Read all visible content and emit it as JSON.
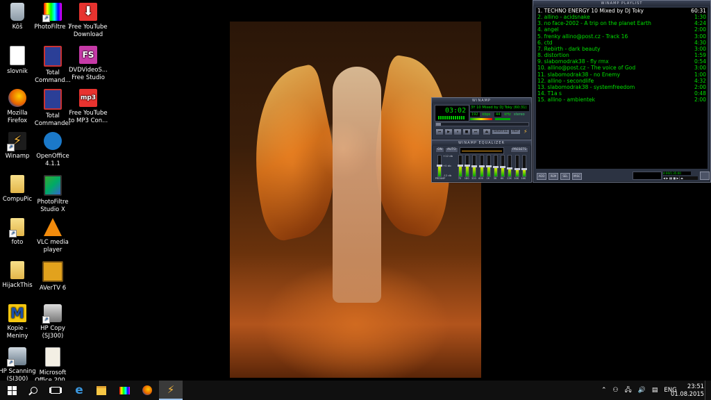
{
  "desktop": {
    "icons": [
      {
        "label": "Kôš",
        "icon": "recycle-bin-icon"
      },
      {
        "label": "slovnik",
        "icon": "text-file-icon"
      },
      {
        "label": "Mozilla Firefox",
        "icon": "firefox-icon"
      },
      {
        "label": "Winamp",
        "icon": "winamp-icon"
      },
      {
        "label": "CompuPic",
        "icon": "compupic-icon"
      },
      {
        "label": "foto",
        "icon": "folder-icon"
      },
      {
        "label": "HijackThis",
        "icon": "hijackthis-icon"
      },
      {
        "label": "Kopie - Meniny",
        "icon": "meniny-icon"
      },
      {
        "label": "HP Scanning (SJ300)",
        "icon": "scanner-icon"
      },
      {
        "label": "PhotoFiltre 7",
        "icon": "photofiltre-icon"
      },
      {
        "label": "Total Command...",
        "icon": "total-commander-icon"
      },
      {
        "label": "Total Commander",
        "icon": "total-commander-icon"
      },
      {
        "label": "OpenOffice 4.1.1",
        "icon": "openoffice-icon"
      },
      {
        "label": "PhotoFiltre Studio X",
        "icon": "photofiltre-studio-icon"
      },
      {
        "label": "VLC media player",
        "icon": "vlc-icon"
      },
      {
        "label": "AVerTV 6",
        "icon": "avertv-icon"
      },
      {
        "label": "HP Copy (SJ300)",
        "icon": "printer-icon"
      },
      {
        "label": "Microsoft Office 200...",
        "icon": "office-icon"
      },
      {
        "label": "Free YouTube Download",
        "icon": "youtube-download-icon"
      },
      {
        "label": "DVDVideoS... Free Studio",
        "icon": "dvdvideosoft-icon"
      },
      {
        "label": "Free YouTube to MP3 Con...",
        "icon": "youtube-mp3-icon"
      }
    ]
  },
  "winamp": {
    "main_title": "WINAMP",
    "time": "03:02",
    "marquee": "3Y 10 Mixed by DJ Toky (60:31)",
    "kbps": "192",
    "kbps_unit": "kbps",
    "khz": "44",
    "khz_unit": "kHz",
    "channels": "stereo",
    "seek_progress": 0.05,
    "shuffle_label": "SHUFFLE",
    "repeat_label": "REP",
    "eq_button": "EQ",
    "pl_button": "PL",
    "eq_title": "WINAMP EQUALIZER",
    "eq_on": "ON",
    "eq_auto": "AUTO",
    "eq_presets": "PRESETS",
    "eq_db_top": "+12 db",
    "eq_db_mid": "+0 db",
    "eq_db_bot": "-12 db",
    "eq_preamp_label": "PREAMP",
    "eq_bands": [
      {
        "label": "70",
        "level": 0.55
      },
      {
        "label": "180",
        "level": 0.55
      },
      {
        "label": "320",
        "level": 0.5
      },
      {
        "label": "600",
        "level": 0.5
      },
      {
        "label": "1K",
        "level": 0.5
      },
      {
        "label": "3K",
        "level": 0.45
      },
      {
        "label": "6K",
        "level": 0.45
      },
      {
        "label": "12K",
        "level": 0.4
      },
      {
        "label": "14K",
        "level": 0.35
      },
      {
        "label": "16K",
        "level": 0.35
      }
    ],
    "playlist_title": "WINAMP PLAYLIST",
    "playlist": [
      {
        "title": "1. TECHNO ENERGY 10 Mixed by DJ Toky",
        "time": "60:31"
      },
      {
        "title": "2. allino - acidsnake",
        "time": "1:30"
      },
      {
        "title": "3. no face-2002 - A trip on the planet Earth",
        "time": "4:24"
      },
      {
        "title": "4. angel",
        "time": "2:00"
      },
      {
        "title": "5. frenky allino@post.cz - Track 16",
        "time": "3:00"
      },
      {
        "title": "6. ctd",
        "time": "4:30"
      },
      {
        "title": "7. Rebirth - dark beauty",
        "time": "3:00"
      },
      {
        "title": "8. distortion",
        "time": "1:59"
      },
      {
        "title": "9. slabomodrak38 - fly rmx",
        "time": "0:54"
      },
      {
        "title": "10. allino@post.cz - The voice of God",
        "time": "3:00"
      },
      {
        "title": "11. slabomodrak38 - no Enemy",
        "time": "1:00"
      },
      {
        "title": "12. allino - secondlife",
        "time": "4:32"
      },
      {
        "title": "13. slabomodrak38 - systemfreedom",
        "time": "2:00"
      },
      {
        "title": "14. T1a s",
        "time": "0:48"
      },
      {
        "title": "15. allino - ambientek",
        "time": "2:00"
      }
    ],
    "pl_add": "ADD",
    "pl_rem": "REM",
    "pl_sel": "SEL",
    "pl_misc": "MISC",
    "pl_total": "4:00/1:35:00"
  },
  "taskbar": {
    "language": "ENG",
    "time": "23:51",
    "date": "01.08.2015"
  }
}
